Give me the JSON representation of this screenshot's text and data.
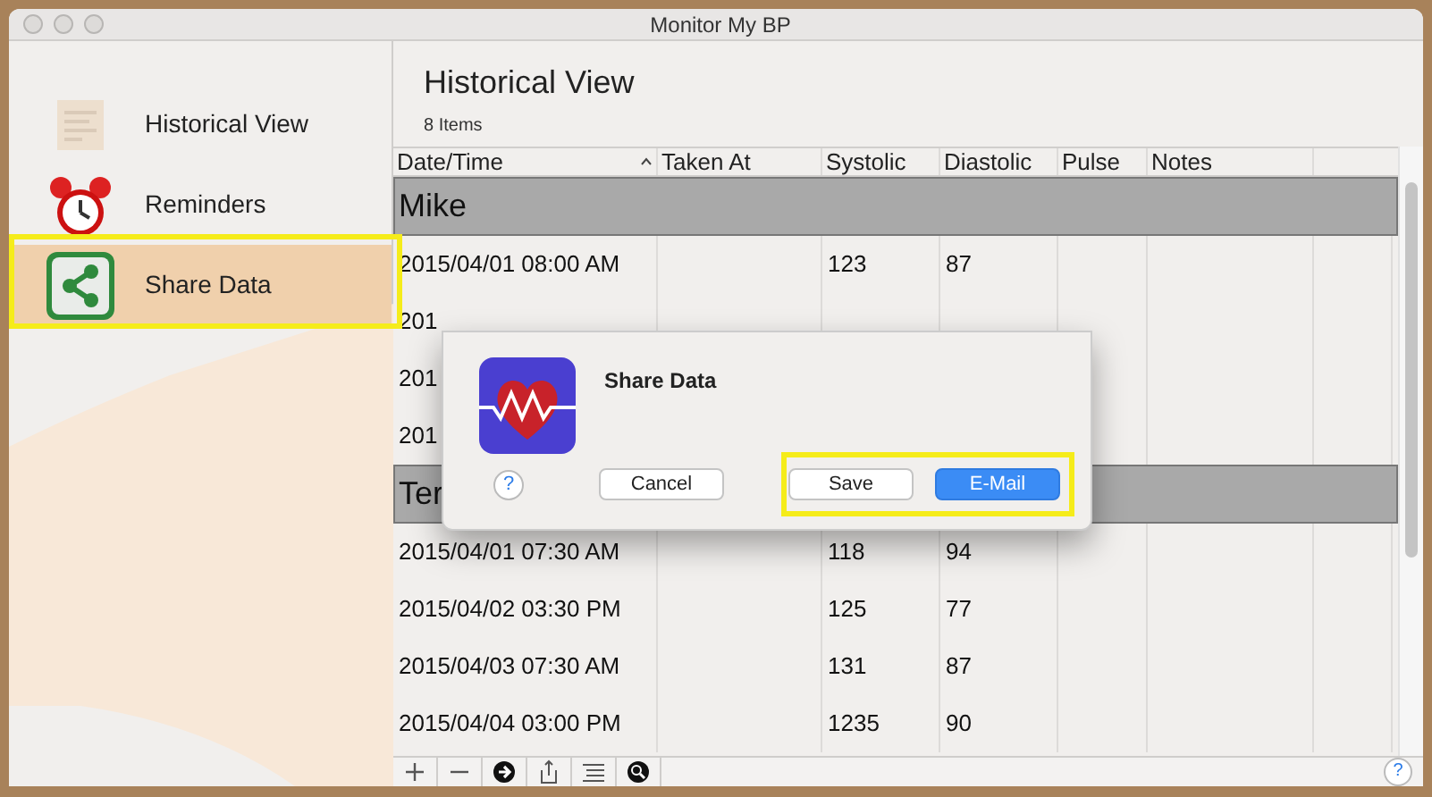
{
  "window": {
    "title": "Monitor My BP"
  },
  "sidebar": {
    "items": [
      {
        "label": "Historical View",
        "kind": "paper",
        "selected": false
      },
      {
        "label": "Reminders",
        "kind": "clock",
        "selected": false
      },
      {
        "label": "Share Data",
        "kind": "share",
        "selected": true
      }
    ]
  },
  "content": {
    "title": "Historical View",
    "count": "8 Items"
  },
  "table": {
    "columns": [
      "Date/Time",
      "Taken At",
      "Systolic",
      "Diastolic",
      "Pulse",
      "Notes"
    ],
    "rows": [
      {
        "kind": "group",
        "cells": [
          "Mike"
        ]
      },
      {
        "kind": "data",
        "cells": [
          "2015/04/01 08:00 AM",
          "",
          "123",
          "87",
          "",
          ""
        ]
      },
      {
        "kind": "data",
        "cells": [
          "201"
        ]
      },
      {
        "kind": "data",
        "cells": [
          "201"
        ]
      },
      {
        "kind": "data",
        "cells": [
          "201"
        ]
      },
      {
        "kind": "group",
        "cells": [
          "Ter"
        ]
      },
      {
        "kind": "data",
        "cells": [
          "2015/04/01 07:30 AM",
          "",
          "118",
          "94",
          "",
          ""
        ]
      },
      {
        "kind": "data",
        "cells": [
          "2015/04/02 03:30 PM",
          "",
          "125",
          "77",
          "",
          ""
        ]
      },
      {
        "kind": "data",
        "cells": [
          "2015/04/03 07:30 AM",
          "",
          "131",
          "87",
          "",
          ""
        ]
      },
      {
        "kind": "data",
        "cells": [
          "2015/04/04 03:00 PM",
          "",
          "1235",
          "90",
          "",
          ""
        ]
      }
    ]
  },
  "dialog": {
    "title": "Share Data",
    "help": "?",
    "buttons": [
      {
        "label": "Cancel",
        "default": false
      },
      {
        "label": "Save",
        "default": false
      },
      {
        "label": "E-Mail",
        "default": true
      }
    ]
  },
  "toolbar": {
    "help": "?"
  }
}
